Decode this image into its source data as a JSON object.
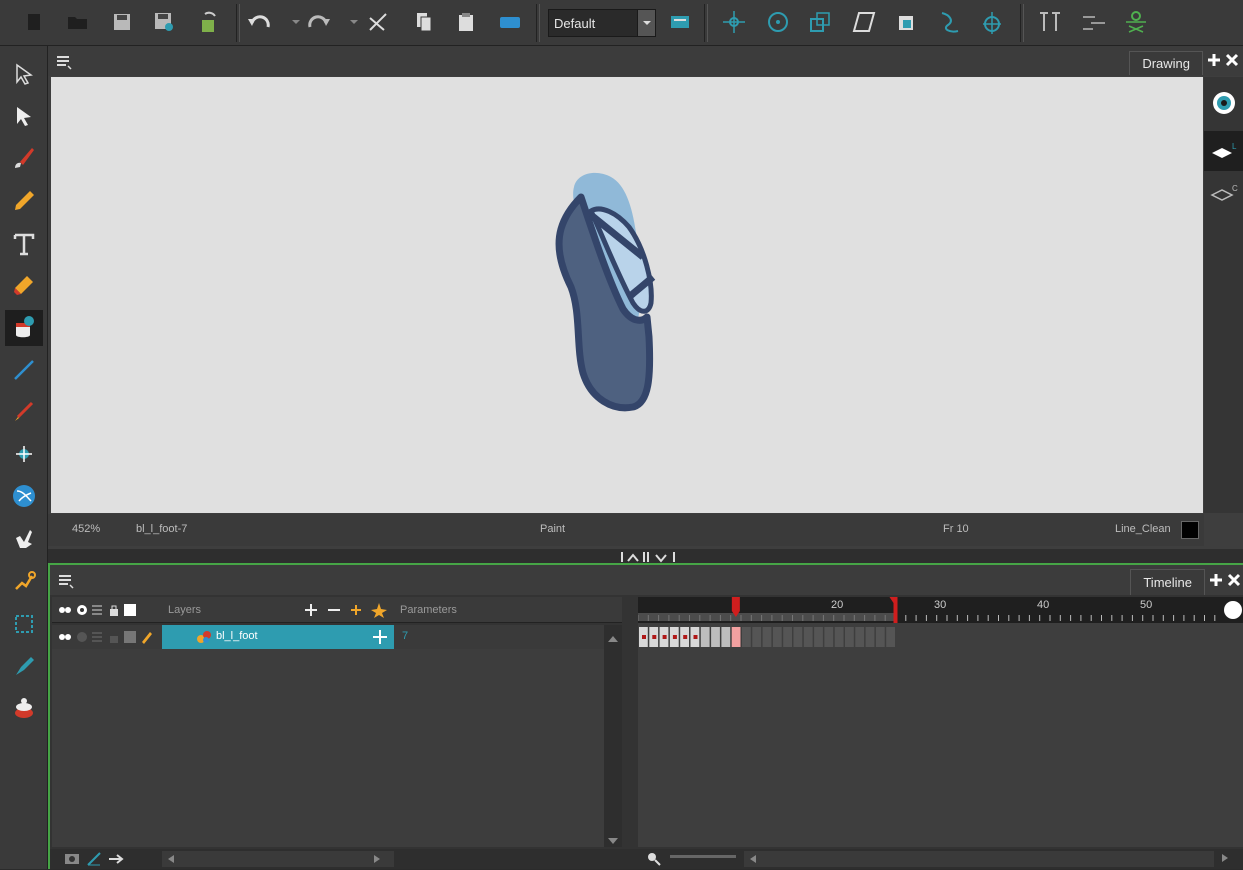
{
  "toolbar": {
    "workspace_value": "Default",
    "icons": [
      "new-icon",
      "open-icon",
      "save-icon",
      "save-as-icon",
      "import-icon",
      "undo-icon",
      "redo-icon",
      "cut-icon",
      "copy-icon",
      "paste-icon",
      "library-icon",
      "camera-view-icon",
      "transform-icon",
      "rotate-icon",
      "scale-icon",
      "skew-icon",
      "morph-icon",
      "spline-icon",
      "pivot-icon",
      "rigging-icon",
      "deform-icon",
      "bone-icon"
    ]
  },
  "drawing_view": {
    "tab_label": "Drawing",
    "zoom": "452%",
    "drawing_name": "bl_l_foot-7",
    "tool_name": "Paint",
    "frame": "Fr 10",
    "palette": "Line_Clean"
  },
  "timeline": {
    "tab_label": "Timeline",
    "layers_header": "Layers",
    "parameters_header": "Parameters",
    "layer": {
      "name": "bl_l_foot",
      "parameter": "7"
    },
    "ruler_labels": [
      "20",
      "30",
      "40",
      "50"
    ],
    "current_frame": 10,
    "playback_end": 25
  },
  "colors": {
    "accent": "#2e9cb0",
    "shoe_fill": "#4e6180",
    "shoe_line": "#34456a",
    "shoe_light": "#b9d3ea",
    "shoe_toe": "#90b9d8"
  }
}
